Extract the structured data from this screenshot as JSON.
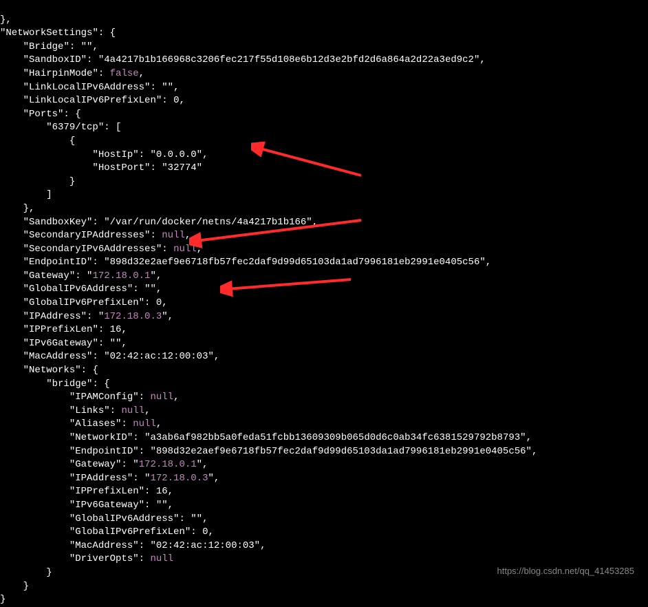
{
  "rootKey": "NetworkSettings",
  "bridge_key": "Bridge",
  "bridge_val": "\"\"",
  "sandboxid_key": "SandboxID",
  "sandboxid_val": "\"4a4217b1b166968c3206fec217f55d108e6b12d3e2bfd2d6a864a2d22a3ed9c2\"",
  "hairpin_key": "HairpinMode",
  "hairpin_val": "false",
  "linklocal_key": "LinkLocalIPv6Address",
  "linklocal_val": "\"\"",
  "linklocalprefix_key": "LinkLocalIPv6PrefixLen",
  "linklocalprefix_val": "0",
  "ports_key": "Ports",
  "port_proto": "6379/tcp",
  "hostip_key": "HostIp",
  "hostip_val": "\"0.0.0.0\"",
  "hostport_key": "HostPort",
  "hostport_val": "\"32774\"",
  "sandboxkey_key": "SandboxKey",
  "sandboxkey_val": "\"/var/run/docker/netns/4a4217b1b166\"",
  "secondaryip_key": "SecondaryIPAddresses",
  "secondaryip_val": "null",
  "secondaryipv6_key": "SecondaryIPv6Addresses",
  "secondaryipv6_val": "null",
  "endpointid_key": "EndpointID",
  "endpointid_val": "\"898d32e2aef9e6718fb57fec2daf9d99d65103da1ad7996181eb2991e0405c56\"",
  "gateway_key": "Gateway",
  "gateway_val": "172.18.0.1",
  "globalipv6addr_key": "GlobalIPv6Address",
  "globalipv6addr_val": "\"\"",
  "globalipv6prefix_key": "GlobalIPv6PrefixLen",
  "globalipv6prefix_val": "0",
  "ipaddress_key": "IPAddress",
  "ipaddress_val": "172.18.0.3",
  "ipprefixlen_key": "IPPrefixLen",
  "ipprefixlen_val": "16",
  "ipv6gateway_key": "IPv6Gateway",
  "ipv6gateway_val": "\"\"",
  "macaddress_key": "MacAddress",
  "macaddress_val": "\"02:42:ac:12:00:03\"",
  "networks_key": "Networks",
  "bridge_net_key": "bridge",
  "ipamconfig_key": "IPAMConfig",
  "ipamconfig_val": "null",
  "links_key": "Links",
  "links_val": "null",
  "aliases_key": "Aliases",
  "aliases_val": "null",
  "networkid_key": "NetworkID",
  "networkid_val": "\"a3ab6af982bb5a0feda51fcbb13609309b065d0d6c0ab34fc6381529792b8793\"",
  "net_endpointid_key": "EndpointID",
  "net_endpointid_val": "\"898d32e2aef9e6718fb57fec2daf9d99d65103da1ad7996181eb2991e0405c56\"",
  "net_gateway_key": "Gateway",
  "net_gateway_val": "172.18.0.1",
  "net_ipaddress_key": "IPAddress",
  "net_ipaddress_val": "172.18.0.3",
  "net_ipprefixlen_key": "IPPrefixLen",
  "net_ipprefixlen_val": "16",
  "net_ipv6gateway_key": "IPv6Gateway",
  "net_ipv6gateway_val": "\"\"",
  "net_globalipv6addr_key": "GlobalIPv6Address",
  "net_globalipv6addr_val": "\"\"",
  "net_globalipv6prefix_key": "GlobalIPv6PrefixLen",
  "net_globalipv6prefix_val": "0",
  "net_macaddress_key": "MacAddress",
  "net_macaddress_val": "\"02:42:ac:12:00:03\"",
  "driveropts_key": "DriverOpts",
  "driveropts_val": "null",
  "watermark": "https://blog.csdn.net/qq_41453285"
}
